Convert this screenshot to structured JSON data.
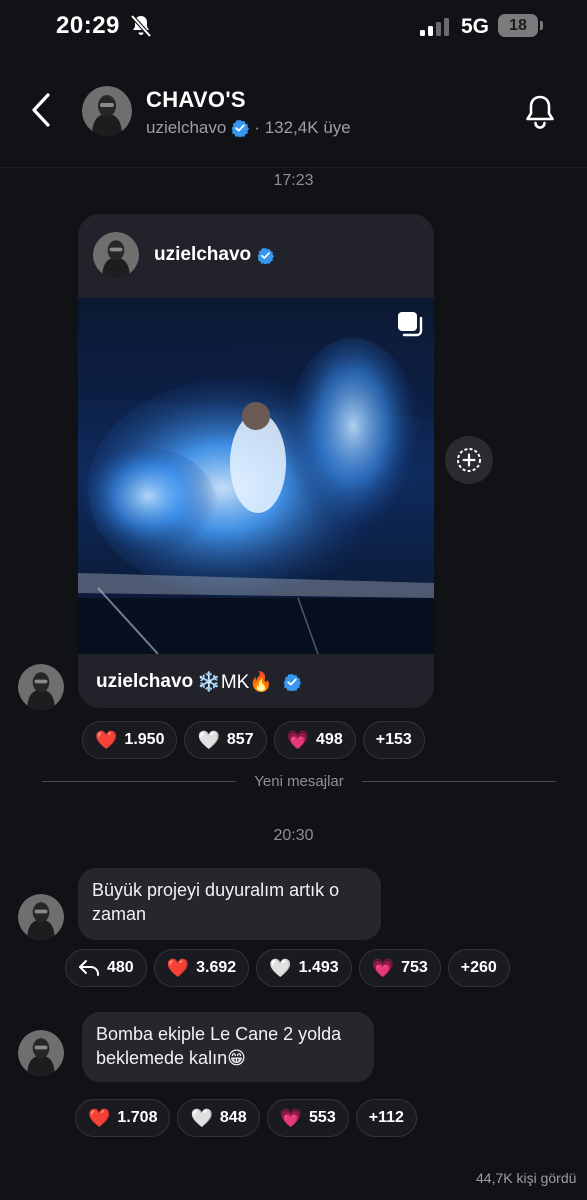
{
  "status_bar": {
    "time": "20:29",
    "network": "5G",
    "battery": "18"
  },
  "header": {
    "channel_name": "CHAVO'S",
    "handle": "uzielchavo",
    "members": "· 132,4K üye"
  },
  "time_separators": {
    "first": "17:23",
    "second": "20:30"
  },
  "shared_post": {
    "username": "uzielchavo",
    "caption_name": "uzielchavo",
    "caption_text": "❄️MK🔥"
  },
  "post_reactions": [
    {
      "emoji": "❤️",
      "count": "1.950"
    },
    {
      "emoji": "🤍",
      "count": "857"
    },
    {
      "emoji": "💗",
      "count": "498"
    },
    {
      "emoji": "",
      "count": "+153"
    }
  ],
  "new_messages_label": "Yeni mesajlar",
  "messages": [
    {
      "text": "Büyük projeyi duyuralım artık o zaman",
      "reply_count": "480",
      "reactions": [
        {
          "emoji": "❤️",
          "count": "3.692"
        },
        {
          "emoji": "🤍",
          "count": "1.493"
        },
        {
          "emoji": "💗",
          "count": "753"
        },
        {
          "emoji": "",
          "count": "+260"
        }
      ]
    },
    {
      "text": "Bomba ekiple Le Cane 2 yolda beklemede kalın😁",
      "reactions": [
        {
          "emoji": "❤️",
          "count": "1.708"
        },
        {
          "emoji": "🤍",
          "count": "848"
        },
        {
          "emoji": "💗",
          "count": "553"
        },
        {
          "emoji": "",
          "count": "+112"
        }
      ]
    }
  ],
  "seen_by": "44,7K kişi gördü",
  "colors": {
    "background": "#111216",
    "bubble": "#26272d",
    "verified": "#3797f0"
  }
}
